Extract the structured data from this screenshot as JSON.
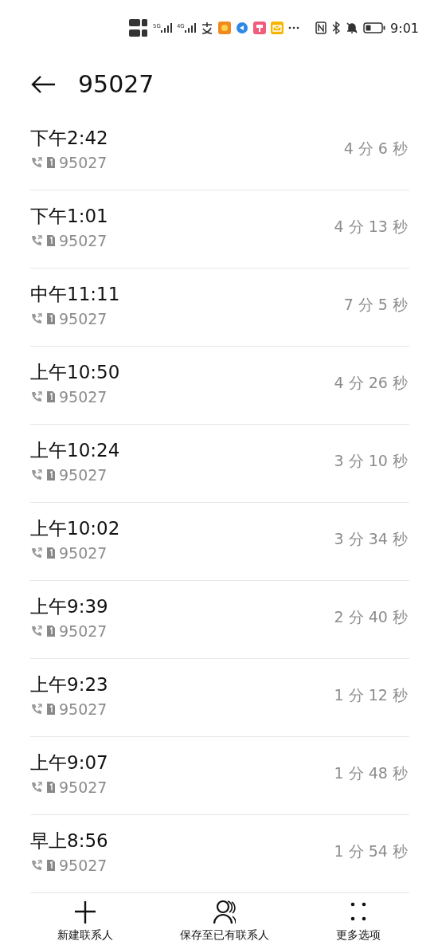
{
  "status_bar": {
    "networks": [
      "5G",
      "4G"
    ],
    "time": "9:01"
  },
  "header": {
    "title": "95027"
  },
  "calls": [
    {
      "time": "下午2:42",
      "number": "95027",
      "duration": "4 分 6 秒"
    },
    {
      "time": "下午1:01",
      "number": "95027",
      "duration": "4 分 13 秒"
    },
    {
      "time": "中午11:11",
      "number": "95027",
      "duration": "7 分 5 秒"
    },
    {
      "time": "上午10:50",
      "number": "95027",
      "duration": "4 分 26 秒"
    },
    {
      "time": "上午10:24",
      "number": "95027",
      "duration": "3 分 10 秒"
    },
    {
      "time": "上午10:02",
      "number": "95027",
      "duration": "3 分 34 秒"
    },
    {
      "time": "上午9:39",
      "number": "95027",
      "duration": "2 分 40 秒"
    },
    {
      "time": "上午9:23",
      "number": "95027",
      "duration": "1 分 12 秒"
    },
    {
      "time": "上午9:07",
      "number": "95027",
      "duration": "1 分 48 秒"
    },
    {
      "time": "早上8:56",
      "number": "95027",
      "duration": "1 分 54 秒"
    }
  ],
  "actions": [
    {
      "kind": "add",
      "label": "新建联系人"
    },
    {
      "kind": "person",
      "label": "保存至已有联系人"
    },
    {
      "kind": "more",
      "label": "更多选项"
    }
  ]
}
